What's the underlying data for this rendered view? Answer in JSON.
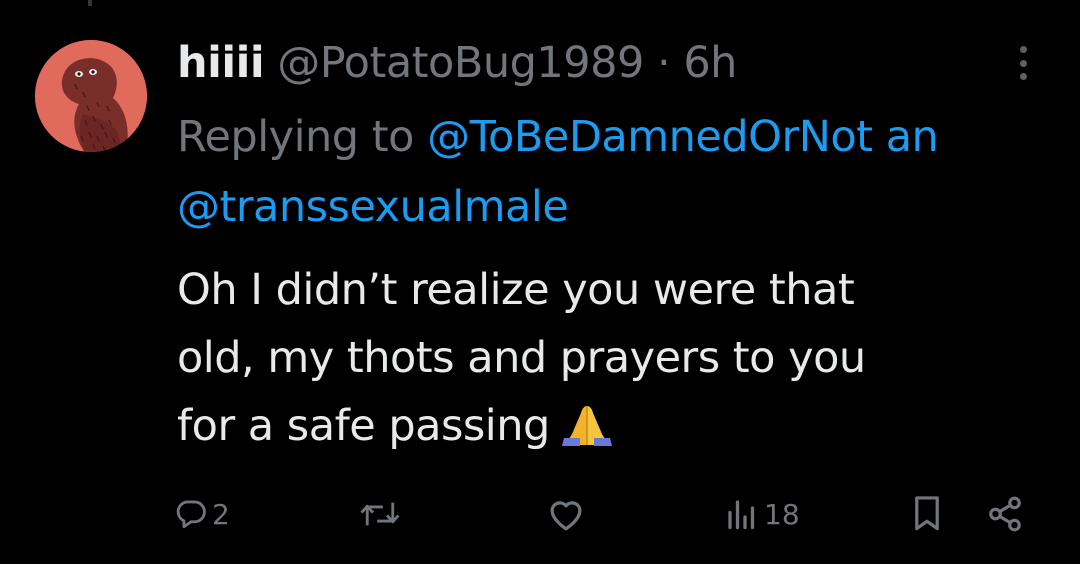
{
  "tweet": {
    "author": {
      "display_name": "hiiii",
      "handle": "@PotatoBug1989",
      "separator": "·",
      "time": "6h"
    },
    "replying_to": {
      "prefix": "Replying to",
      "first_mention": "@ToBeDamnedOrNot",
      "joiner": "an",
      "second_mention": "@transsexualmale"
    },
    "text_lines": [
      "Oh I didn’t realize you were that",
      "old, my thots and prayers to you",
      "for a safe passing"
    ],
    "emoji_icon": "folded-hands-icon",
    "actions": {
      "reply": {
        "icon": "reply-icon",
        "count": "2"
      },
      "retweet": {
        "icon": "retweet-icon",
        "count": ""
      },
      "like": {
        "icon": "heart-icon",
        "count": ""
      },
      "views": {
        "icon": "views-icon",
        "count": "18"
      },
      "bookmark": {
        "icon": "bookmark-icon"
      },
      "share": {
        "icon": "share-icon"
      }
    }
  },
  "colors": {
    "background": "#000000",
    "text": "#e7e9ea",
    "muted": "#71767b",
    "link": "#1d9bf0",
    "avatar_bg": "#e06a5c"
  }
}
